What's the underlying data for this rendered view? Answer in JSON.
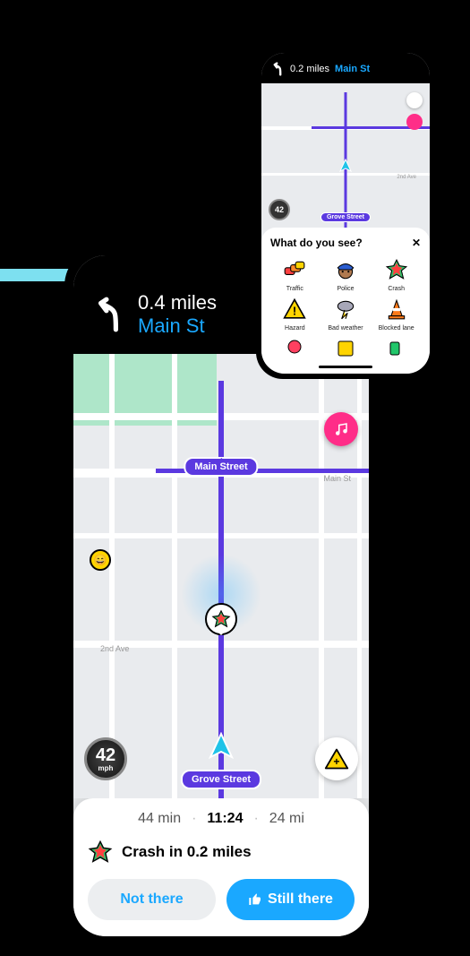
{
  "big": {
    "nav": {
      "distance": "0.4 miles",
      "street": "Main St"
    },
    "map": {
      "main_pill": "Main Street",
      "grove_pill": "Grove Street",
      "road_main": "Main St",
      "road_2nd": "2nd Ave",
      "speed_value": "42",
      "speed_unit": "mph"
    },
    "trip": {
      "time": "44 min",
      "eta": "11:24",
      "dist": "24 mi"
    },
    "alert": "Crash in 0.2 miles",
    "buttons": {
      "not_there": "Not there",
      "still_there": "Still there"
    }
  },
  "small": {
    "nav": {
      "distance": "0.2 miles",
      "street": "Main St"
    },
    "map": {
      "grove_pill": "Grove Street",
      "road_2nd": "2nd Ave",
      "speed": "42"
    },
    "sheet": {
      "title": "What do you see?",
      "items": {
        "traffic": "Traffic",
        "police": "Police",
        "crash": "Crash",
        "hazard": "Hazard",
        "weather": "Bad weather",
        "blocked": "Blocked lane"
      }
    }
  }
}
